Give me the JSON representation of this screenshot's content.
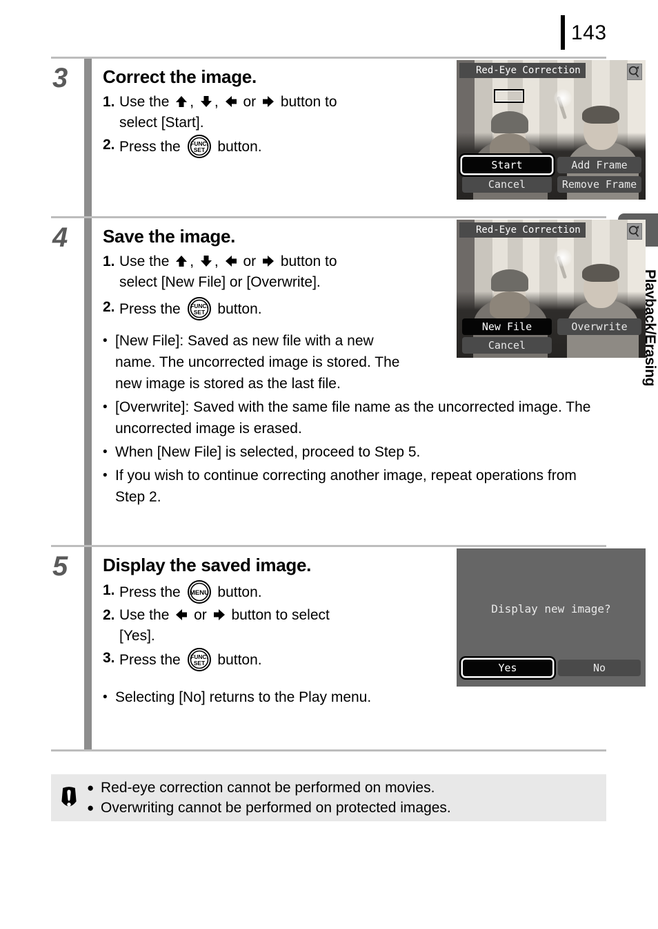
{
  "page": {
    "number": "143",
    "side_tab_label": "Playback/Erasing"
  },
  "icons": {
    "up_arrow": "up-arrow-icon",
    "down_arrow": "down-arrow-icon",
    "left_arrow": "left-arrow-icon",
    "right_arrow": "right-arrow-icon",
    "func_set": "func-set-button-icon",
    "menu": "menu-button-icon",
    "func_line1": "FUNC.",
    "func_line2": "SET",
    "menu_label": "MENU",
    "magnifier": "magnifier-icon",
    "red_eye": "red-eye-icon",
    "caution": "caution-icon"
  },
  "steps": [
    {
      "number": "3",
      "title": "Correct the image.",
      "items": [
        {
          "marker": "1.",
          "pre": "Use the",
          "mid": ",",
          "mid2": ",",
          "or": "or",
          "post": "button to",
          "line2": "select [Start]."
        },
        {
          "marker": "2.",
          "pre": "Press the",
          "post": "button."
        }
      ]
    },
    {
      "number": "4",
      "title": "Save the image.",
      "items": [
        {
          "marker": "1.",
          "pre": "Use the",
          "mid": ",",
          "mid2": ",",
          "or": "or",
          "post": "button to",
          "line2": "select [New File] or [Overwrite]."
        },
        {
          "marker": "2.",
          "pre": "Press the",
          "post": "button."
        }
      ],
      "bullets": [
        "[New File]: Saved as new file with a new name. The uncorrected image is stored. The new image is stored as the last file.",
        "[Overwrite]: Saved with the same file name as the uncorrected image. The uncorrected image is erased.",
        "When [New File] is selected, proceed to Step 5.",
        "If you wish to continue correcting another image, repeat operations from Step 2."
      ]
    },
    {
      "number": "5",
      "title": "Display the saved image.",
      "items": [
        {
          "marker": "1.",
          "pre": "Press the",
          "post": "button."
        },
        {
          "marker": "2.",
          "pre": "Use the",
          "or": "or",
          "post": "button to select",
          "line2": "[Yes]."
        },
        {
          "marker": "3.",
          "pre": "Press the",
          "post": "button."
        }
      ],
      "bullets": [
        "Selecting [No] returns to the Play menu."
      ]
    }
  ],
  "screens": {
    "step3": {
      "title": "Red-Eye Correction",
      "buttons": [
        {
          "label": "Start",
          "selected": true
        },
        {
          "label": "Add Frame",
          "selected": false
        },
        {
          "label": "Cancel",
          "selected": false
        },
        {
          "label": "Remove Frame",
          "selected": false
        }
      ]
    },
    "step4": {
      "title": "Red-Eye Correction",
      "buttons": [
        {
          "label": "New File",
          "selected": true
        },
        {
          "label": "Overwrite",
          "selected": false
        },
        {
          "label": "Cancel",
          "selected": false
        }
      ]
    },
    "step5": {
      "message": "Display new image?",
      "buttons": [
        {
          "label": "Yes",
          "selected": true
        },
        {
          "label": "No",
          "selected": false
        }
      ]
    }
  },
  "caution": {
    "items": [
      "Red-eye correction cannot be performed on movies.",
      "Overwriting cannot be performed on protected images.",
      "•"
    ],
    "bullet": "●"
  },
  "bullets": {
    "dot": "•"
  }
}
